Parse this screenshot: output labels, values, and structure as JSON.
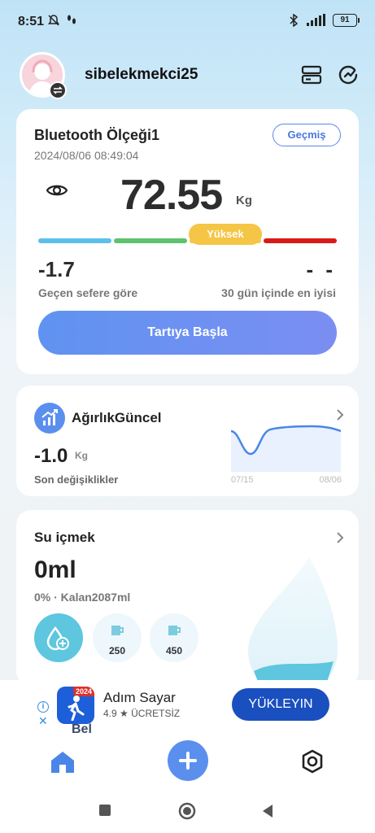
{
  "status_bar": {
    "time": "8:51",
    "battery": "91"
  },
  "header": {
    "username": "sibelekmekci25"
  },
  "scale_card": {
    "device_name": "Bluetooth Ölçeği1",
    "date": "2024/08/06 08:49:04",
    "history_label": "Geçmiş",
    "weight": "72.55",
    "unit": "Kg",
    "level": "Yüksek",
    "diff_value": "-1.7",
    "diff_label": "Geçen sefere göre",
    "best_value": "- -",
    "best_label": "30 gün içinde en iyisi",
    "start_label": "Tartıya Başla",
    "bar_colors": [
      "#5bc0ea",
      "#5ec36d",
      "#f5c545",
      "#d91a1a"
    ]
  },
  "trend_card": {
    "title": "AğırlıkGüncel",
    "value": "-1.0",
    "unit": "Kg",
    "label": "Son değişiklikler",
    "x_start": "07/15",
    "x_end": "08/06"
  },
  "water_card": {
    "title": "Su içmek",
    "amount": "0ml",
    "info": "0% · Kalan2087ml",
    "cups": [
      {
        "label": "250"
      },
      {
        "label": "450"
      }
    ]
  },
  "ad": {
    "app_name": "Adım Sayar",
    "rating": "4.9 ★  ÜCRETSİZ",
    "install_label": "YÜKLEYIN",
    "badge_year": "2024",
    "peek_text": "Bel"
  }
}
